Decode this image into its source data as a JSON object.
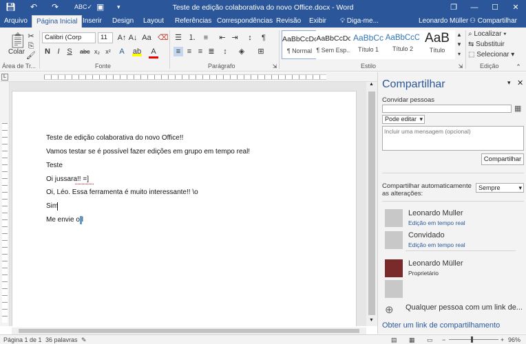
{
  "window": {
    "title": "Teste de edição colaborativa do novo Office.docx - Word",
    "buttons": {
      "restore": "❐",
      "minimize": "—",
      "maximize": "☐",
      "close": "✕"
    }
  },
  "quick_access": {
    "save_icon": "save-icon",
    "undo_icon": "undo-icon",
    "redo_icon": "redo-icon",
    "spell_icon": "spelling-icon",
    "preview_icon": "print-preview-icon",
    "customize_icon": "customize-icon"
  },
  "tabs": [
    "Arquivo",
    "Página Inicial",
    "Inserir",
    "Design",
    "Layout",
    "Referências",
    "Correspondências",
    "Revisão",
    "Exibir"
  ],
  "tell_me": "Diga-me...",
  "user": "Leonardo Müller",
  "share_button": "Compartilhar",
  "ribbon": {
    "clipboard": {
      "paste": "Colar",
      "label": "Área de Tr..."
    },
    "font": {
      "name": "Calibri (Corp",
      "size": "11",
      "label": "Fonte"
    },
    "paragraph": {
      "label": "Parágrafo"
    },
    "styles": {
      "label": "Estilo",
      "items": [
        {
          "preview": "AaBbCcDc",
          "name": "¶ Normal"
        },
        {
          "preview": "AaBbCcDc",
          "name": "¶ Sem Esp..."
        },
        {
          "preview": "AaBbCc",
          "name": "Título 1"
        },
        {
          "preview": "AaBbCcC",
          "name": "Título 2"
        },
        {
          "preview": "AaB",
          "name": "Título"
        }
      ]
    },
    "editing": {
      "find": "Localizar",
      "replace": "Substituir",
      "select": "Selecionar",
      "label": "Edição"
    }
  },
  "document": {
    "paragraphs": [
      "Teste de edição colaborativa do novo Office!!",
      "Vamos testar se é possível fazer edições em grupo em tempo real!",
      "Teste",
      "Oi jussara!! =]",
      "Oi, Léo. Essa ferramenta é muito interessante!!  \\o",
      "Sim",
      "Me envie o l"
    ]
  },
  "share_pane": {
    "title": "Compartilhar",
    "invite_label": "Convidar pessoas",
    "permission": "Pode editar",
    "message_placeholder": "Incluir uma mensagem (opcional)",
    "share_btn": "Compartilhar",
    "auto_label": "Compartilhar automaticamente as alterações:",
    "auto_value": "Sempre",
    "people": [
      {
        "name": "Leonardo Muller",
        "role": "Edição em tempo real"
      },
      {
        "name": "Convidado",
        "role": "Edição em tempo real"
      },
      {
        "name": "Leonardo Müller",
        "role": "Proprietário"
      },
      {
        "name": "",
        "role": ""
      }
    ],
    "anyone_link": "Qualquer pessoa com um link de...",
    "get_link": "Obter um link de compartilhamento"
  },
  "status": {
    "page": "Página 1 de 1",
    "words": "36 palavras",
    "zoom": "96%"
  },
  "colors": {
    "accent": "#2b579a",
    "ribbon_bg": "#f3f3f3"
  }
}
